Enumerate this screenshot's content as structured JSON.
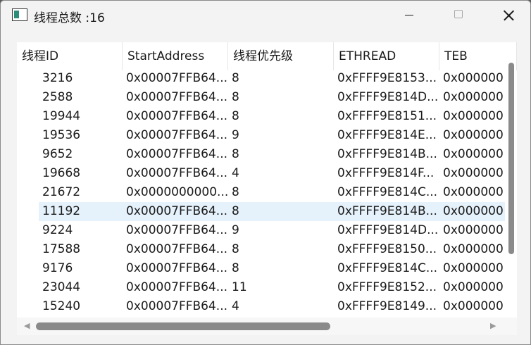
{
  "window": {
    "title": "线程总数 :16",
    "icons": {
      "app": "app-window-icon",
      "minimize": "minimize-icon",
      "maximize": "maximize-icon",
      "close": "close-icon"
    }
  },
  "table": {
    "columns": [
      "线程ID",
      "StartAddress",
      "线程优先级",
      "ETHREAD",
      "TEB"
    ],
    "selected_row": 7,
    "rows": [
      [
        "3216",
        "0x00007FFB64...",
        "8",
        "0xFFFF9E8153...",
        "0x000000"
      ],
      [
        "2588",
        "0x00007FFB64...",
        "8",
        "0xFFFF9E814D...",
        "0x000000"
      ],
      [
        "19944",
        "0x00007FFB64...",
        "8",
        "0xFFFF9E8151...",
        "0x000000"
      ],
      [
        "19536",
        "0x00007FFB64...",
        "9",
        "0xFFFF9E814E...",
        "0x000000"
      ],
      [
        "9652",
        "0x00007FFB64...",
        "8",
        "0xFFFF9E814B...",
        "0x000000"
      ],
      [
        "19668",
        "0x00007FFB64...",
        "4",
        "0xFFFF9E814F...",
        "0x000000"
      ],
      [
        "21672",
        "0x0000000000...",
        "8",
        "0xFFFF9E814C...",
        "0x000000"
      ],
      [
        "11192",
        "0x00007FFB64...",
        "8",
        "0xFFFF9E814B...",
        "0x000000"
      ],
      [
        "9224",
        "0x00007FFB64...",
        "9",
        "0xFFFF9E814D...",
        "0x000000"
      ],
      [
        "17588",
        "0x00007FFB64...",
        "8",
        "0xFFFF9E8150...",
        "0x000000"
      ],
      [
        "9176",
        "0x00007FFB64...",
        "8",
        "0xFFFF9E814C...",
        "0x000000"
      ],
      [
        "23044",
        "0x00007FFB64...",
        "11",
        "0xFFFF9E8152...",
        "0x000000"
      ],
      [
        "15240",
        "0x00007FFB64...",
        "4",
        "0xFFFF9E8149...",
        "0x000000"
      ]
    ]
  },
  "scrollbar": {
    "left_arrow": "◀",
    "right_arrow": "▶"
  },
  "colors": {
    "selection": "#e5f1fb",
    "window_bg": "#f3f3f3",
    "list_bg": "#ffffff"
  }
}
